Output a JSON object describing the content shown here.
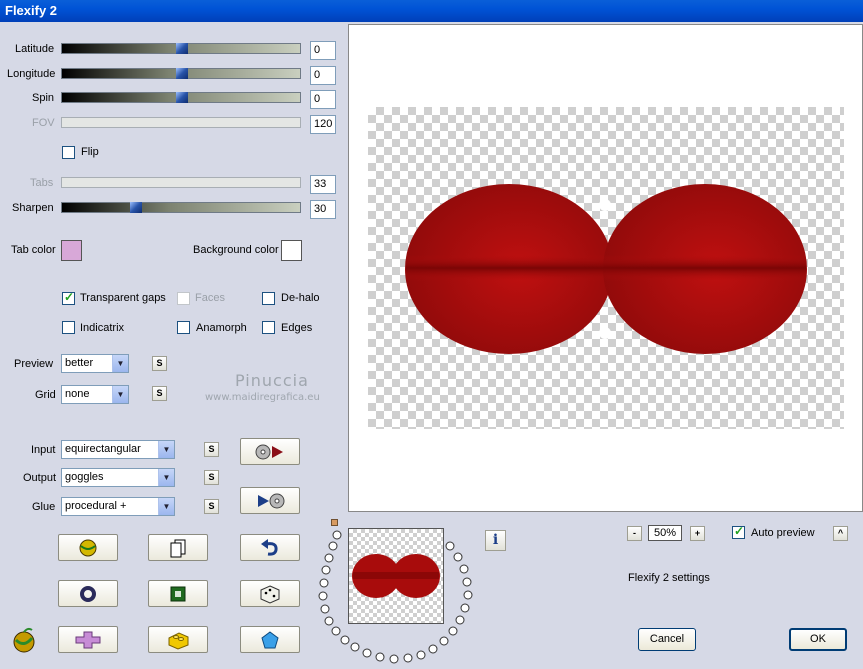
{
  "window": {
    "title": "Flexify 2"
  },
  "sliders": [
    {
      "label": "Latitude",
      "value": "0",
      "disabled": false
    },
    {
      "label": "Longitude",
      "value": "0",
      "disabled": false
    },
    {
      "label": "Spin",
      "value": "0",
      "disabled": false
    },
    {
      "label": "FOV",
      "value": "120",
      "disabled": true
    },
    {
      "label": "Tabs",
      "value": "33",
      "disabled": true
    },
    {
      "label": "Sharpen",
      "value": "30",
      "disabled": false
    }
  ],
  "flip": {
    "label": "Flip",
    "checked": false
  },
  "colors": {
    "tab_color_label": "Tab color",
    "tab_color": "#d8a8d8",
    "background_color_label": "Background color",
    "background_color": "#ffffff"
  },
  "options": {
    "transparent_gaps": {
      "label": "Transparent gaps",
      "checked": true
    },
    "faces": {
      "label": "Faces",
      "checked": false
    },
    "de_halo": {
      "label": "De-halo",
      "checked": false
    },
    "indicatrix": {
      "label": "Indicatrix",
      "checked": false
    },
    "anamorph": {
      "label": "Anamorph",
      "checked": false
    },
    "edges": {
      "label": "Edges",
      "checked": false
    }
  },
  "dropdowns": {
    "preview": {
      "label": "Preview",
      "value": "better"
    },
    "grid": {
      "label": "Grid",
      "value": "none"
    },
    "input": {
      "label": "Input",
      "value": "equirectangular"
    },
    "output": {
      "label": "Output",
      "value": "goggles"
    },
    "glue": {
      "label": "Glue",
      "value": "procedural +"
    }
  },
  "small_button_label": "S",
  "watermark": {
    "name": "Pinuccia",
    "url": "www.maidiregrafica.eu"
  },
  "zoom": {
    "value": "50%",
    "minus": "-",
    "plus": "+"
  },
  "auto_preview": {
    "label": "Auto preview",
    "checked": true,
    "button": "^"
  },
  "status": "Flexify 2 settings",
  "buttons": {
    "cancel": "Cancel",
    "ok": "OK",
    "info": "i"
  },
  "accent_colors": {
    "title_bar": "#0053d6",
    "shape_red": "#a80c0c"
  }
}
